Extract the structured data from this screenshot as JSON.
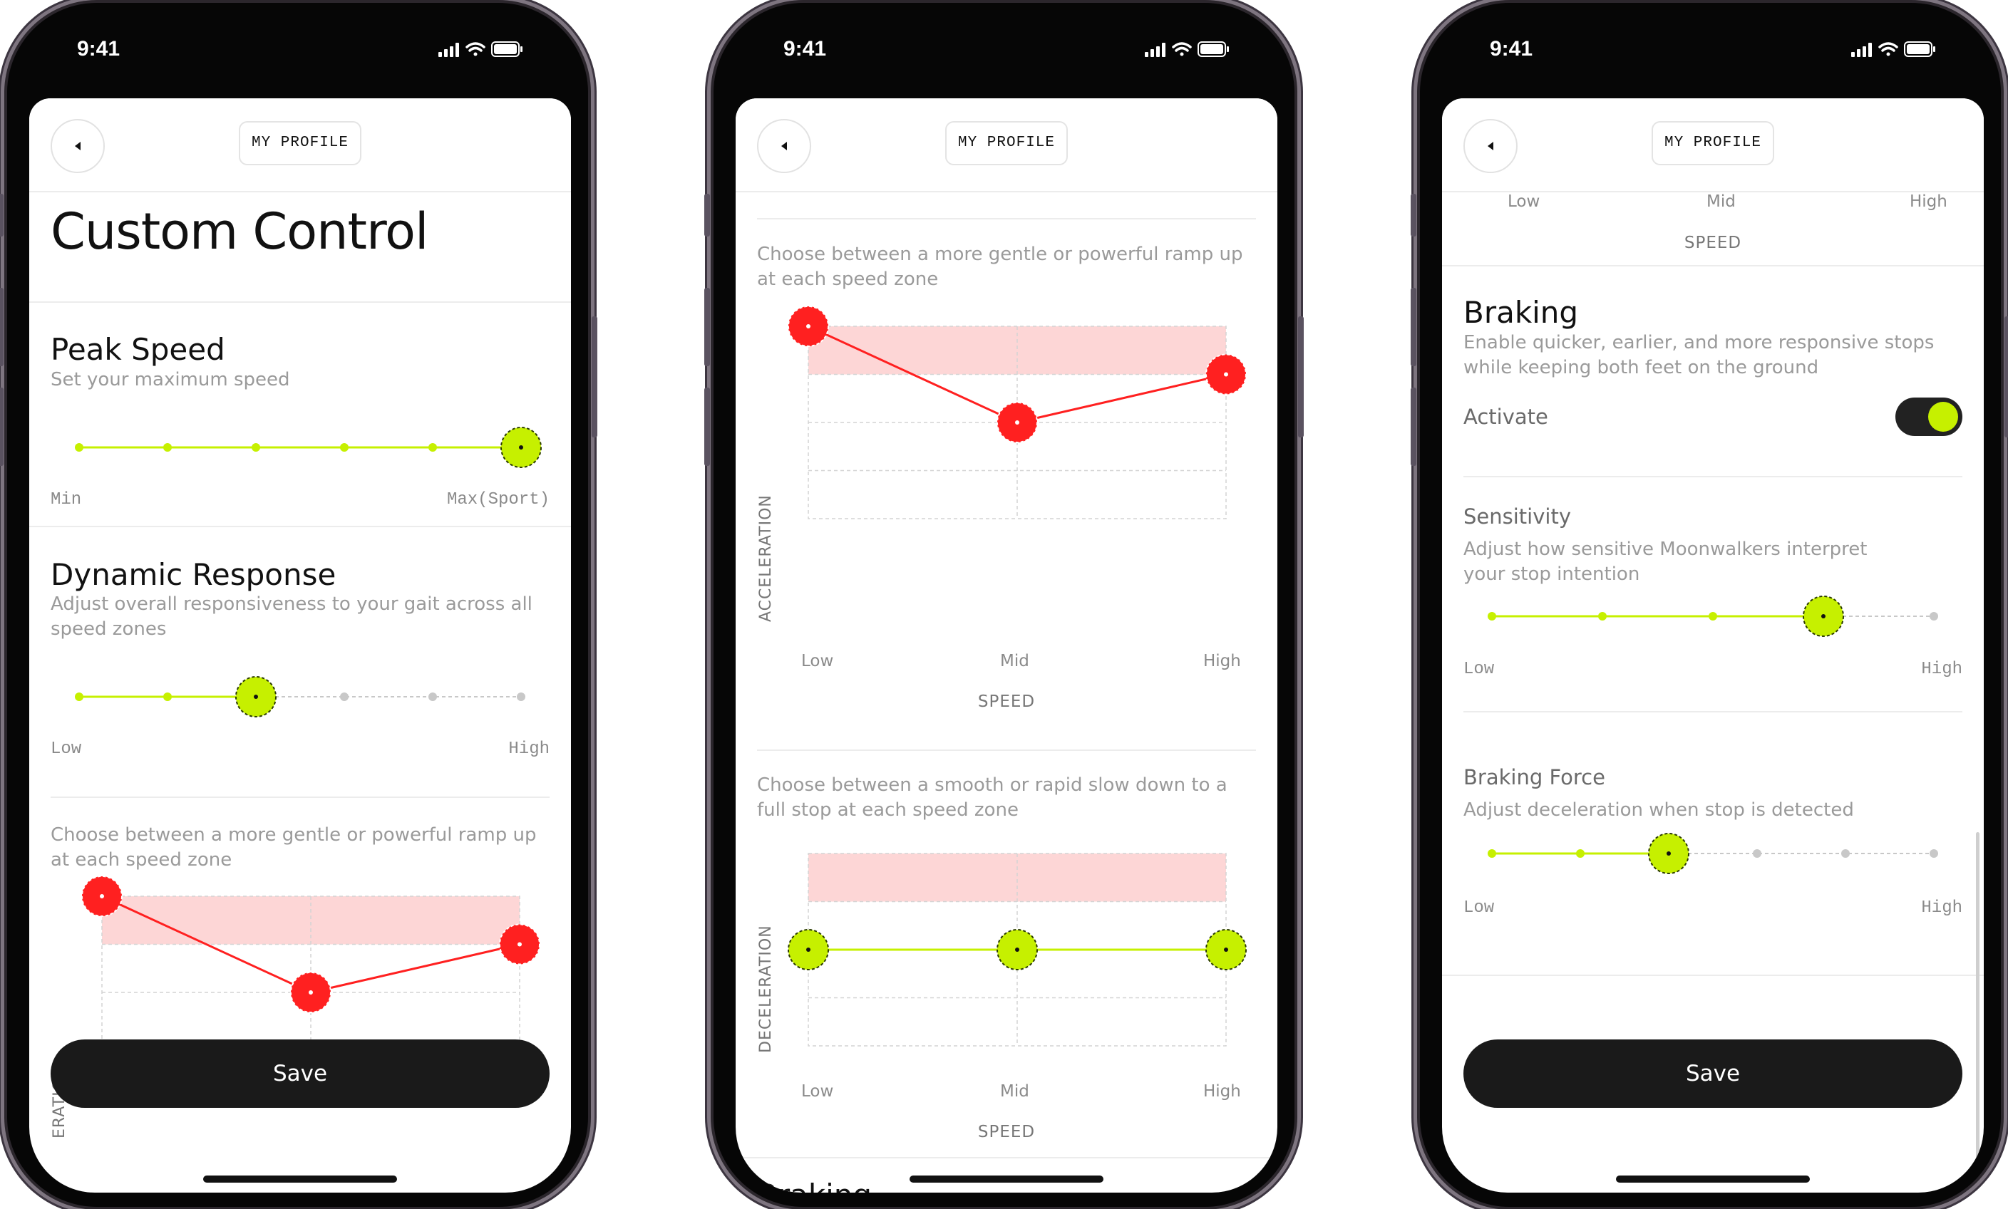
{
  "status": {
    "time": "9:41"
  },
  "header": {
    "title": "MY PROFILE"
  },
  "page": {
    "title": "Custom Control"
  },
  "peak_speed": {
    "title": "Peak Speed",
    "desc": "Set your maximum speed",
    "min_label": "Min",
    "max_label": "Max(Sport)",
    "steps": 6,
    "selected": 6
  },
  "dynamic_response": {
    "title": "Dynamic Response",
    "desc": "Adjust overall responsiveness to your gait across all speed zones",
    "low_label": "Low",
    "high_label": "High",
    "steps": 6,
    "selected": 3
  },
  "acceleration": {
    "desc": "Choose between a more gentle or powerful ramp up at each speed zone",
    "ylabel": "ACCELERATION",
    "xlabel": "SPEED",
    "x_low": "Low",
    "x_mid": "Mid",
    "x_high": "High",
    "partial_ylabel": "ERATION",
    "partial_xlabel": "SPEED"
  },
  "deceleration": {
    "desc": "Choose between a smooth or rapid slow down to a full stop at each speed zone",
    "ylabel": "DECELERATION",
    "xlabel": "SPEED",
    "x_low": "Low",
    "x_mid": "Mid",
    "x_high": "High"
  },
  "braking": {
    "title": "Braking",
    "desc": "Enable quicker, earlier, and more responsive stops while keeping both feet on the ground",
    "activate_label": "Activate",
    "active": true
  },
  "sensitivity": {
    "title": "Sensitivity",
    "desc": "Adjust how sensitive Moonwalkers interpret your stop intention",
    "low_label": "Low",
    "high_label": "High",
    "steps": 5,
    "selected": 4
  },
  "braking_force": {
    "title": "Braking Force",
    "desc": "Adjust deceleration when stop is detected",
    "low_label": "Low",
    "high_label": "High",
    "steps": 6,
    "selected": 3
  },
  "save_label": "Save",
  "chart_data": [
    {
      "type": "line",
      "categories": [
        "Low",
        "Mid",
        "High"
      ],
      "values": [
        4,
        2,
        3
      ],
      "ylim": [
        0,
        4
      ],
      "xlabel": "SPEED",
      "ylabel": "ACCELERATION"
    },
    {
      "type": "line",
      "categories": [
        "Low",
        "Mid",
        "High"
      ],
      "values": [
        2,
        2,
        2
      ],
      "ylim": [
        0,
        4
      ],
      "xlabel": "SPEED",
      "ylabel": "DECELERATION"
    }
  ],
  "colors": {
    "accent": "#c6f000",
    "alert": "#ff2020",
    "alert_band": "#fdd6d6",
    "dark": "#1a1a1a"
  }
}
